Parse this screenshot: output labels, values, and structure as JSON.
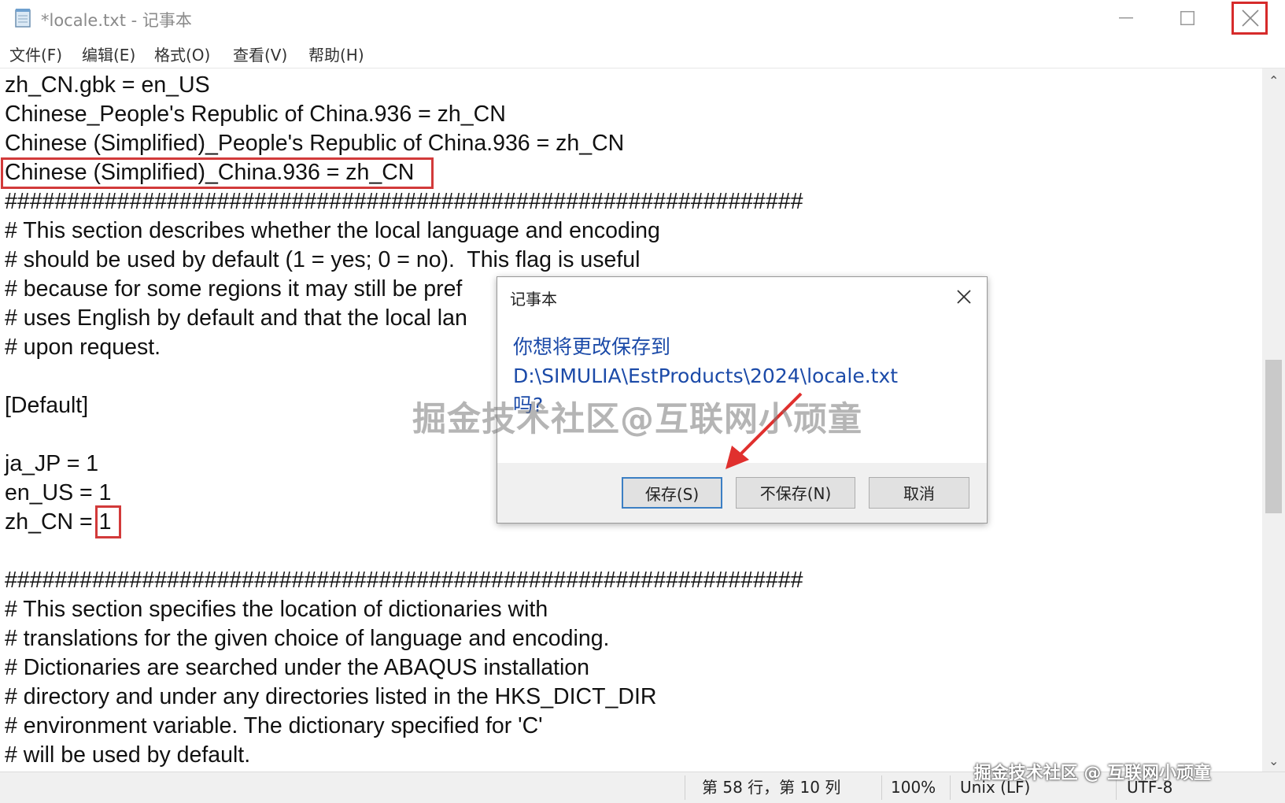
{
  "window": {
    "title": "*locale.txt - 记事本"
  },
  "menu": [
    "文件(F)",
    "编辑(E)",
    "格式(O)",
    "查看(V)",
    "帮助(H)"
  ],
  "editor": {
    "lines": [
      "zh_CN.gbk = en_US",
      "Chinese_People's Republic of China.936 = zh_CN",
      "Chinese (Simplified)_People's Republic of China.936 = zh_CN",
      "Chinese (Simplified)_China.936 = zh_CN",
      "################################################################",
      "# This section describes whether the local language and encoding",
      "# should be used by default (1 = yes; 0 = no).  This flag is useful",
      "# because for some regions it may still be pref",
      "# uses English by default and that the local lan",
      "# upon request.",
      "",
      "[Default]",
      "",
      "ja_JP = 1",
      "en_US = 1",
      "zh_CN = 1",
      "",
      "################################################################",
      "# This section specifies the location of dictionaries with",
      "# translations for the given choice of language and encoding.",
      "# Dictionaries are searched under the ABAQUS installation",
      "# directory and under any directories listed in the HKS_DICT_DIR",
      "# environment variable. The dictionary specified for 'C'",
      "# will be used by default."
    ]
  },
  "status": {
    "position": "第 58 行，第 10 列",
    "zoom": "100%",
    "line_ending": "Unix (LF)",
    "encoding": "UTF-8"
  },
  "dialog": {
    "title": "记事本",
    "message_line1": "你想将更改保存到",
    "message_line2": "D:\\SIMULIA\\EstProducts\\2024\\locale.txt",
    "message_line3": "吗?",
    "save_label": "保存(S)",
    "dont_save_label": "不保存(N)",
    "cancel_label": "取消"
  },
  "watermark": {
    "center": "掘金技术社区@互联网小顽童",
    "corner": "掘金技术社区 @ 互联网小顽童"
  },
  "colors": {
    "highlight": "#d23a3a",
    "dialog_text": "#1b4aa8",
    "default_button_border": "#3c7fc4"
  }
}
